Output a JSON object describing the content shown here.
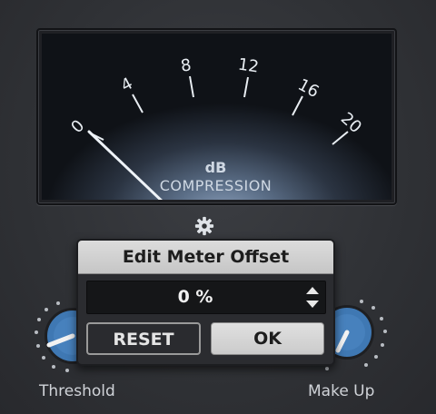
{
  "meter": {
    "scale": [
      "0",
      "4",
      "8",
      "12",
      "16",
      "20"
    ],
    "unit": "dB",
    "caption": "COMPRESSION"
  },
  "settings_icon": "gear-icon",
  "dialog": {
    "title": "Edit Meter Offset",
    "value": "0 %",
    "reset_label": "RESET",
    "ok_label": "OK"
  },
  "knobs": {
    "threshold_label": "Threshold",
    "makeup_label": "Make Up"
  },
  "colors": {
    "knob_blue": "#3f78b3",
    "dialog_title_bg": "#d4d4d4"
  }
}
